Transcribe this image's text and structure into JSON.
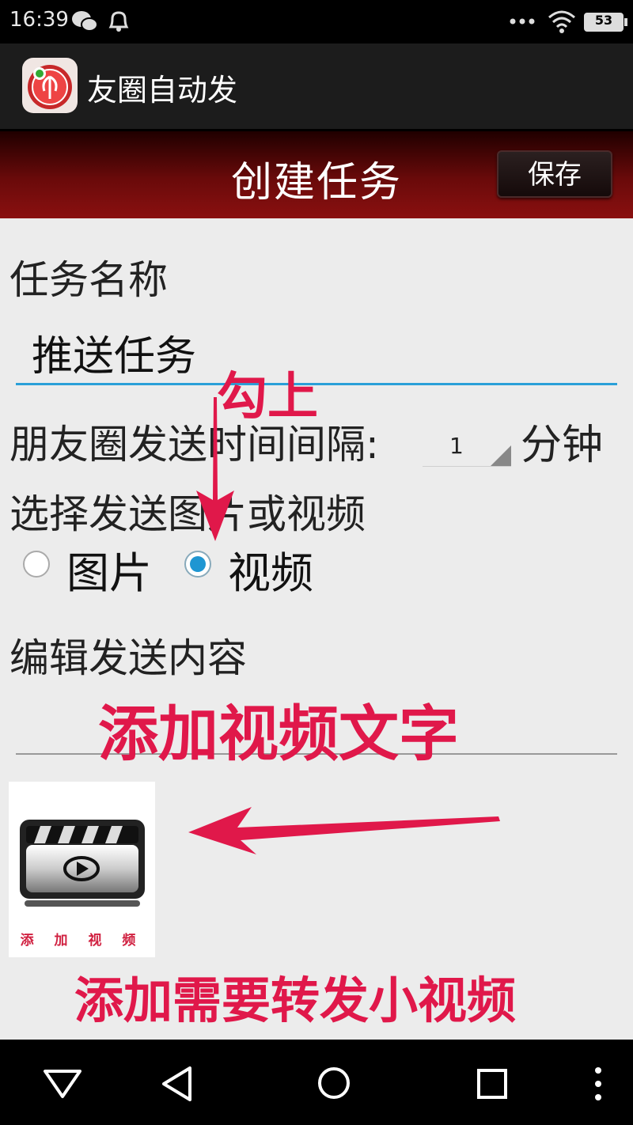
{
  "status": {
    "time": "16:39",
    "battery": "53"
  },
  "app": {
    "title": "友圈自动发"
  },
  "header": {
    "title": "创建任务",
    "save_label": "保存"
  },
  "form": {
    "task_name_label": "任务名称",
    "task_name_value": "推送任务",
    "interval_label": "朋友圈发送时间间隔:",
    "interval_value": "1",
    "interval_unit": "分钟",
    "media_label": "选择发送图片或视频",
    "option_image": "图片",
    "option_video": "视频",
    "selected_option": "视频",
    "content_label": "编辑发送内容",
    "add_video_label": "添 加 视 频"
  },
  "annotations": {
    "check_it": "勾上",
    "add_video_text": "添加视频文字",
    "add_forward_video": "添加需要转发小视频"
  },
  "colors": {
    "accent": "#1e96d2",
    "annotation": "#e0184a",
    "header_dark": "#6a0a0a"
  }
}
